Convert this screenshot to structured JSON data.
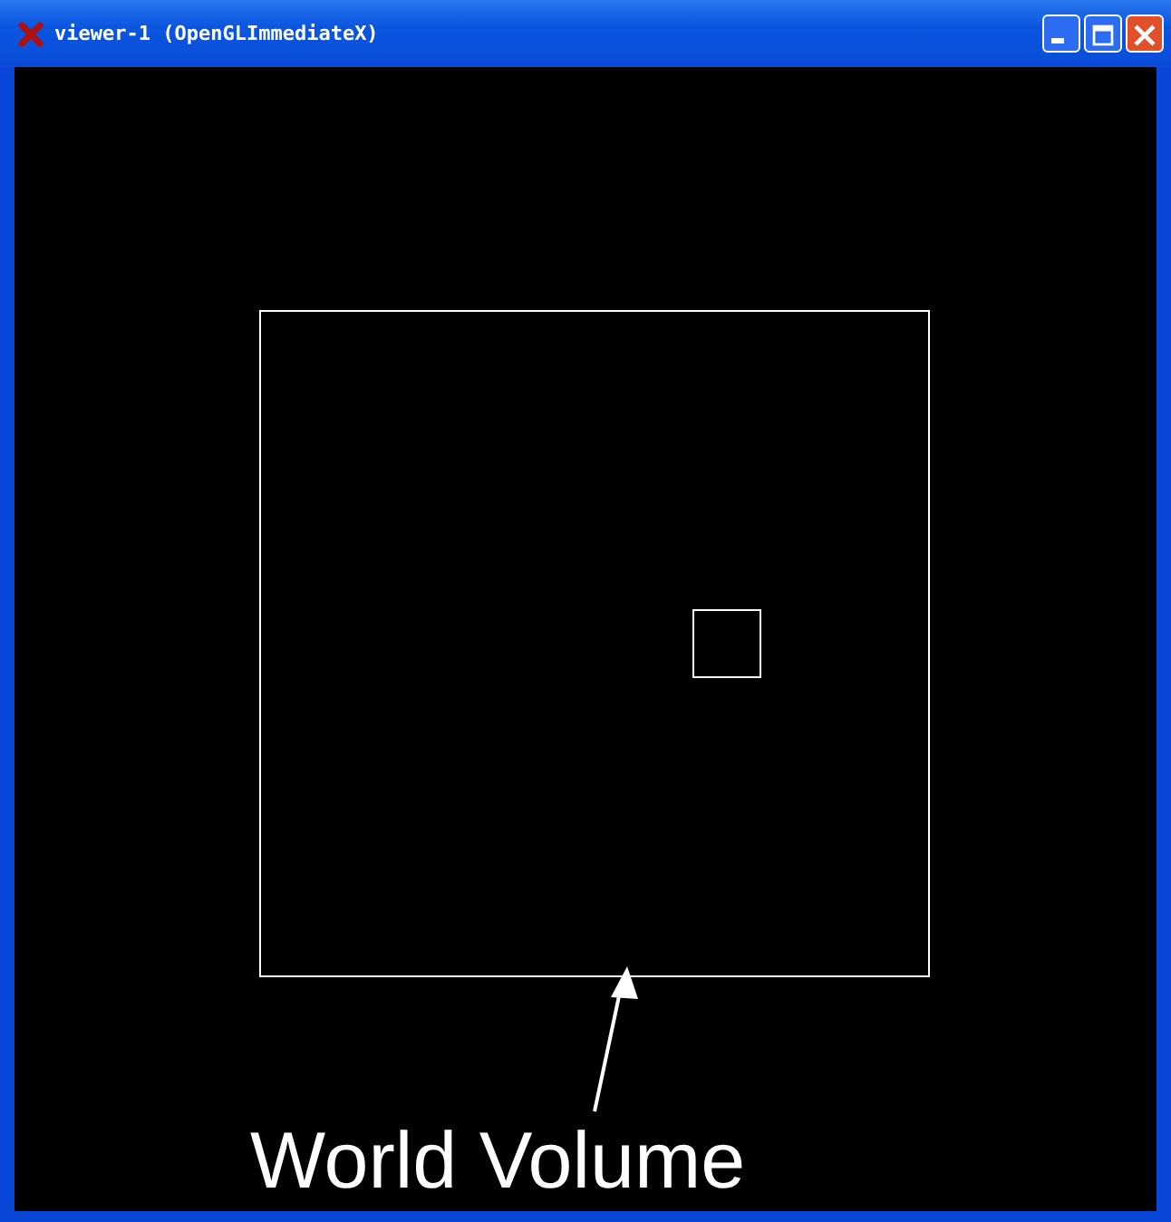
{
  "window": {
    "title": "viewer-1 (OpenGLImmediateX)"
  },
  "annotation": {
    "label": "World Volume"
  }
}
